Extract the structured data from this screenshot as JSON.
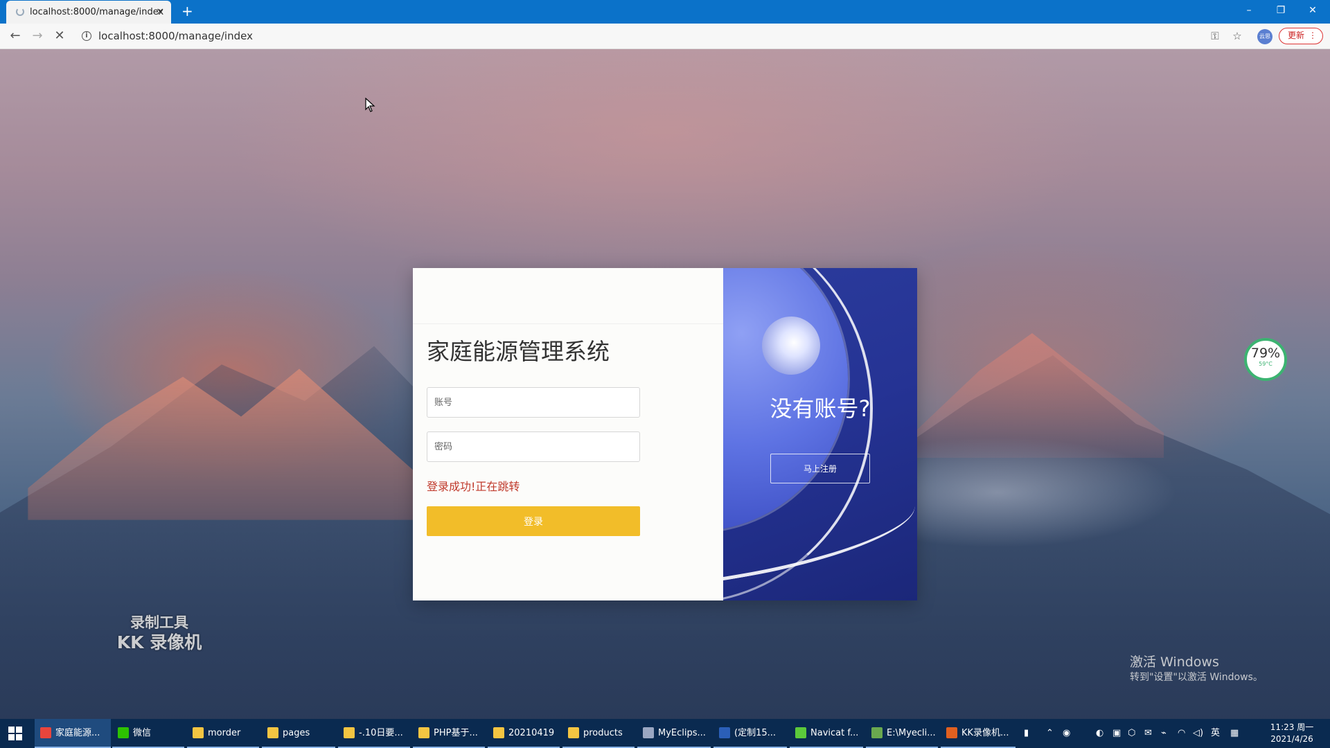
{
  "browser": {
    "tab_title": "localhost:8000/manage/index",
    "tab_close": "×",
    "new_tab": "+",
    "url": "localhost:8000/manage/index",
    "update_label": "更新",
    "profile_label": "云思",
    "win_minimize": "–",
    "win_restore": "❐",
    "win_close": "✕"
  },
  "login": {
    "title": "家庭能源管理系统",
    "account_placeholder": "账号",
    "password_placeholder": "密码",
    "status_message": "登录成功!正在跳转",
    "login_button": "登录",
    "status_color": "#c0392b",
    "button_color": "#f2bd29"
  },
  "register_panel": {
    "heading": "没有账号?",
    "register_button": "马上注册"
  },
  "overlays": {
    "temp_percent": "79%",
    "temp_celsius": "59°C",
    "recorder_line1": "录制工具",
    "recorder_line2": "KK 录像机",
    "activate_line1": "激活 Windows",
    "activate_line2": "转到\"设置\"以激活 Windows。"
  },
  "taskbar": {
    "items": [
      {
        "label": "家庭能源...",
        "icon": "chrome-icon",
        "color": "#e8453c"
      },
      {
        "label": "微信",
        "icon": "wechat-icon",
        "color": "#2dc100"
      },
      {
        "label": "morder",
        "icon": "folder-icon",
        "color": "#f4c542"
      },
      {
        "label": "pages",
        "icon": "folder-icon",
        "color": "#f4c542"
      },
      {
        "label": "-.10日要...",
        "icon": "folder-icon",
        "color": "#f4c542"
      },
      {
        "label": "PHP基于...",
        "icon": "folder-icon",
        "color": "#f4c542"
      },
      {
        "label": "20210419",
        "icon": "folder-icon",
        "color": "#f4c542"
      },
      {
        "label": "products",
        "icon": "folder-icon",
        "color": "#f4c542"
      },
      {
        "label": "MyEclips...",
        "icon": "myeclipse-icon",
        "color": "#9aa7c2"
      },
      {
        "label": "(定制15...",
        "icon": "word-icon",
        "color": "#2b5fb8"
      },
      {
        "label": "Navicat f...",
        "icon": "navicat-icon",
        "color": "#5cc93b"
      },
      {
        "label": "E:\\Myecli...",
        "icon": "notepad-icon",
        "color": "#6aa84f"
      },
      {
        "label": "KK录像机...",
        "icon": "kk-recorder-icon",
        "color": "#e06020"
      }
    ],
    "ime_label": "英",
    "clock_time": "11:23 周一",
    "clock_date": "2021/4/26"
  }
}
